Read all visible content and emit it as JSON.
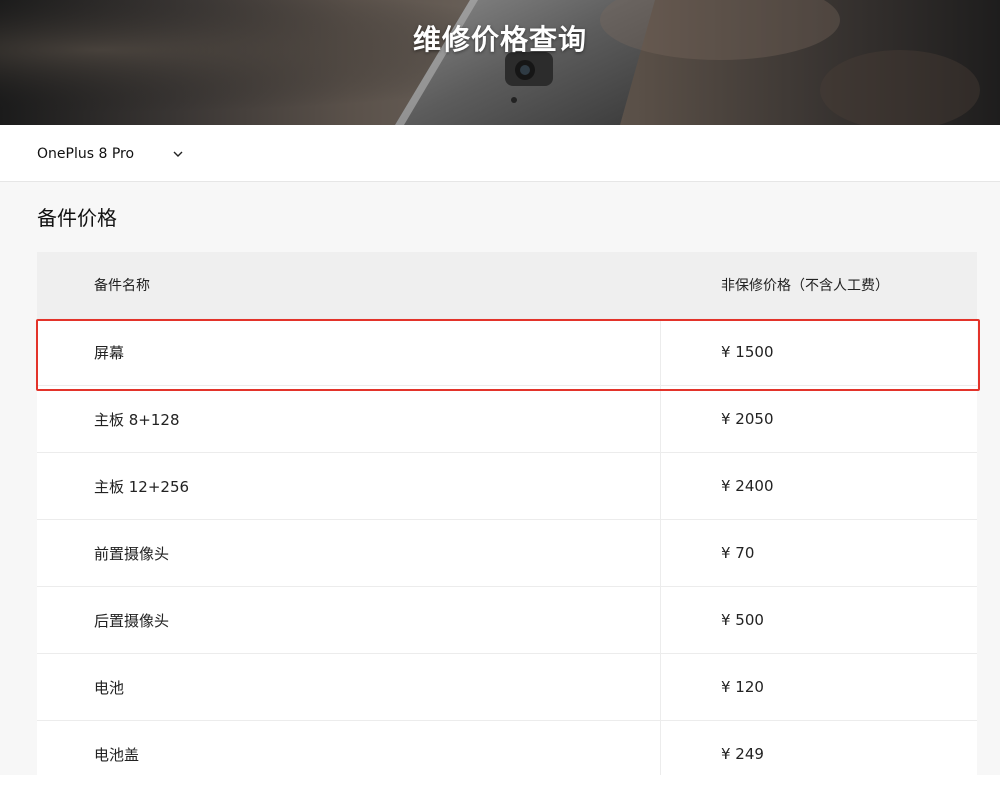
{
  "hero": {
    "title": "维修价格查询"
  },
  "model_selector": {
    "selected": "OnePlus 8 Pro"
  },
  "section": {
    "title": "备件价格"
  },
  "table": {
    "headers": {
      "name": "备件名称",
      "price": "非保修价格（不含人工费）"
    },
    "rows": [
      {
        "name": "屏幕",
        "price": "¥ 1500"
      },
      {
        "name": "主板 8+128",
        "price": "¥ 2050"
      },
      {
        "name": "主板 12+256",
        "price": "¥ 2400"
      },
      {
        "name": "前置摄像头",
        "price": "¥ 70"
      },
      {
        "name": "后置摄像头",
        "price": "¥ 500"
      },
      {
        "name": "电池",
        "price": "¥ 120"
      },
      {
        "name": "电池盖",
        "price": "¥ 249"
      }
    ]
  },
  "colors": {
    "highlight_border": "#e3332a",
    "header_bg": "#efefef",
    "page_bg": "#f7f7f7"
  },
  "icons": {
    "dropdown": "chevron-down-icon"
  }
}
